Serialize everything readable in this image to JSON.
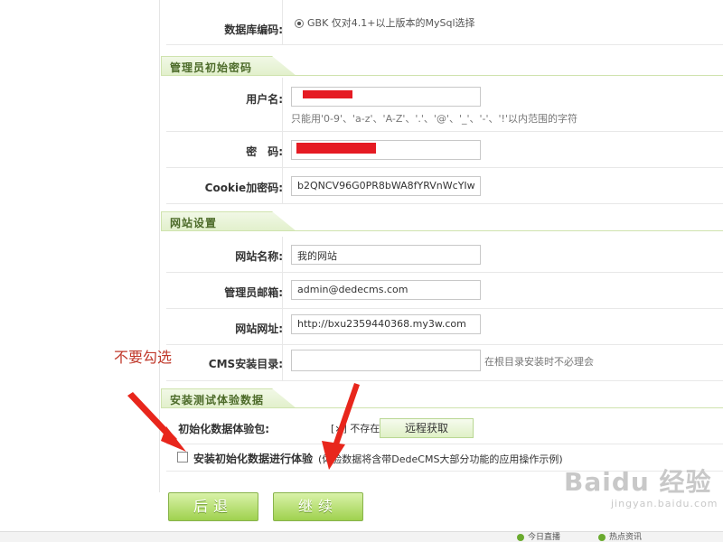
{
  "db_encoding": {
    "label": "数据库编码:",
    "option_text": "GBK 仅对4.1+以上版本的MySql选择"
  },
  "admin_section": {
    "title": "管理员初始密码",
    "username_label": "用户名:",
    "username_hint": "只能用'0-9'、'a-z'、'A-Z'、'.'、'@'、'_'、'-'、'!'以内范围的字符",
    "password_label": "密　码:",
    "cookie_label": "Cookie加密码:",
    "cookie_value": "b2QNCV96G0PR8bWA8fYRVnWcYIw"
  },
  "site_section": {
    "title": "网站设置",
    "name_label": "网站名称:",
    "name_value": "我的网站",
    "email_label": "管理员邮箱:",
    "email_value": "admin@dedecms.com",
    "url_label": "网站网址:",
    "url_value": "http://bxu2359440368.my3w.com",
    "dir_label": "CMS安装目录:",
    "dir_value": "",
    "dir_hint": "在根目录安装时不必理会"
  },
  "test_section": {
    "title": "安装测试体验数据",
    "pkg_label": "初始化数据体验包:",
    "pkg_status": "[×] 不存在",
    "fetch_button": "远程获取",
    "checkbox_label": "安装初始化数据进行体验",
    "checkbox_hint": "(体验数据将含带DedeCMS大部分功能的应用操作示例)"
  },
  "buttons": {
    "back": "后退",
    "continue": "继续"
  },
  "annotation": "不要勾选",
  "statusbar": {
    "item1": "今日直播",
    "item2": "热点资讯"
  },
  "watermark": {
    "brand": "Baidu 经验",
    "url": "jingyan.baidu.com"
  },
  "colors": {
    "accent_green": "#9fd14e",
    "redaction": "#e51b23",
    "annotation_red": "#c0392b"
  }
}
